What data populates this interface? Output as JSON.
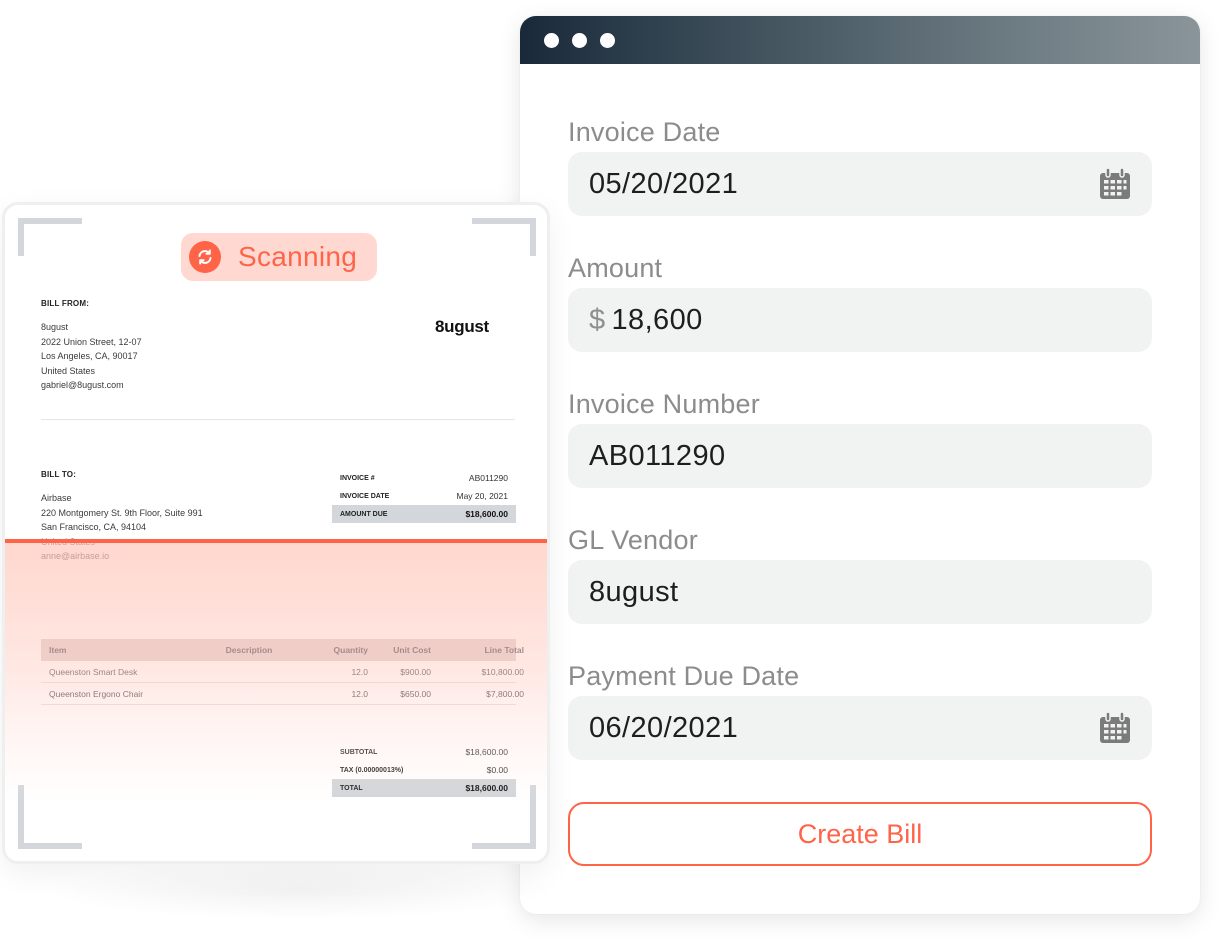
{
  "invoice_preview": {
    "status_badge": {
      "label": "Scanning",
      "icon": "refresh-icon"
    },
    "bill_from": {
      "heading": "BILL FROM:",
      "lines": [
        "8ugust",
        "2022 Union Street, 12-07",
        "Los Angeles, CA, 90017",
        "United States",
        "gabriel@8ugust.com"
      ]
    },
    "vendor_logo": "8ugust",
    "bill_to": {
      "heading": "BILL TO:",
      "lines": [
        "Airbase",
        "220 Montgomery St. 9th Floor, Suite 991",
        "San Francisco, CA, 94104",
        "United States",
        "anne@airbase.io"
      ]
    },
    "meta": [
      {
        "label": "INVOICE #",
        "value": "AB011290"
      },
      {
        "label": "INVOICE DATE",
        "value": "May 20, 2021"
      },
      {
        "label": "AMOUNT DUE",
        "value": "$18,600.00"
      }
    ],
    "line_items": {
      "columns": [
        "Item",
        "Description",
        "Quantity",
        "Unit Cost",
        "Line Total"
      ],
      "rows": [
        {
          "item": "Queenston Smart Desk",
          "description": "",
          "quantity": "12.0",
          "unit_cost": "$900.00",
          "line_total": "$10,800.00"
        },
        {
          "item": "Queenston Ergono Chair",
          "description": "",
          "quantity": "12.0",
          "unit_cost": "$650.00",
          "line_total": "$7,800.00"
        }
      ]
    },
    "totals": [
      {
        "label": "SUBTOTAL",
        "value": "$18,600.00"
      },
      {
        "label": "TAX (0.00000013%)",
        "value": "$0.00"
      },
      {
        "label": "TOTAL",
        "value": "$18,600.00"
      }
    ]
  },
  "bill_form": {
    "fields": [
      {
        "label": "Invoice Date",
        "value": "05/20/2021",
        "icon": "calendar-icon"
      },
      {
        "label": "Amount",
        "currency": "$",
        "value": "18,600"
      },
      {
        "label": "Invoice Number",
        "value": "AB011290"
      },
      {
        "label": "GL Vendor",
        "value": "8ugust"
      },
      {
        "label": "Payment Due Date",
        "value": "06/20/2021",
        "icon": "calendar-icon"
      }
    ],
    "create_button": "Create Bill"
  },
  "colors": {
    "accent": "#ff6448",
    "badge_bg": "#ffd9d1",
    "input_bg": "#f1f2f2",
    "label_gray": "#8c8c8c",
    "titlebar_start": "#19293a",
    "titlebar_end": "#8a959a"
  }
}
